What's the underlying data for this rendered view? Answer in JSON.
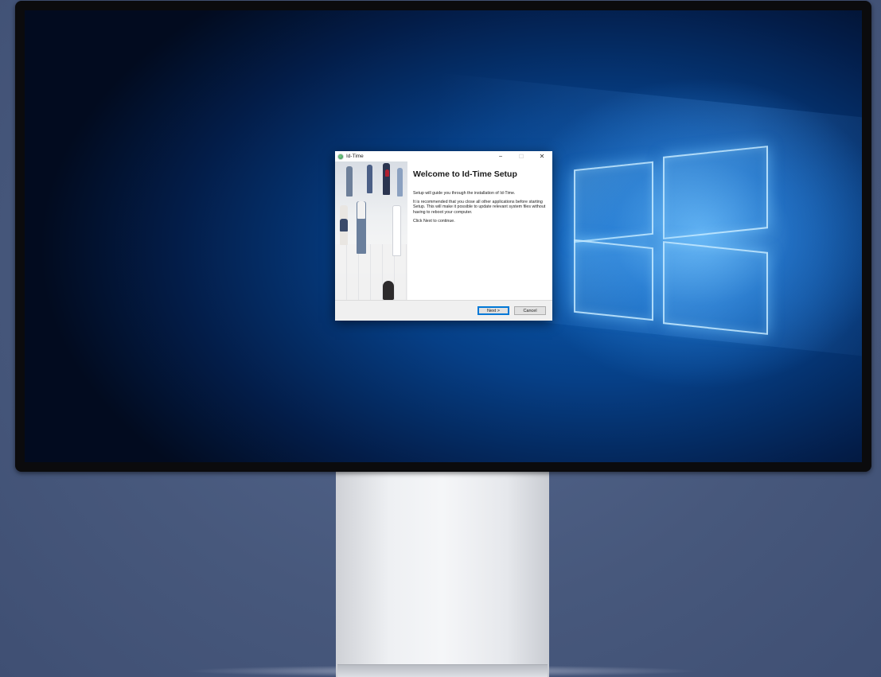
{
  "window": {
    "title": "Id-Time",
    "minimize_glyph": "−",
    "maximize_glyph": "☐",
    "close_glyph": "✕"
  },
  "content": {
    "heading": "Welcome to Id-Time Setup",
    "paragraphs": [
      "Setup will guide you through the installation of Id-Time.",
      "It is recommended that you close all other applications before starting Setup. This will make it possible to update relevant system files without having to reboot your computer.",
      "Click Next to continue."
    ]
  },
  "buttons": {
    "next_label": "Next >",
    "cancel_label": "Cancel"
  },
  "icons": {
    "app": "app-globe-icon",
    "minimize": "minimize-icon",
    "maximize": "maximize-icon",
    "close": "close-icon"
  },
  "colors": {
    "focus_accent": "#0078d7",
    "footer_bg": "#f0f0f0",
    "backdrop": "#47587c"
  }
}
